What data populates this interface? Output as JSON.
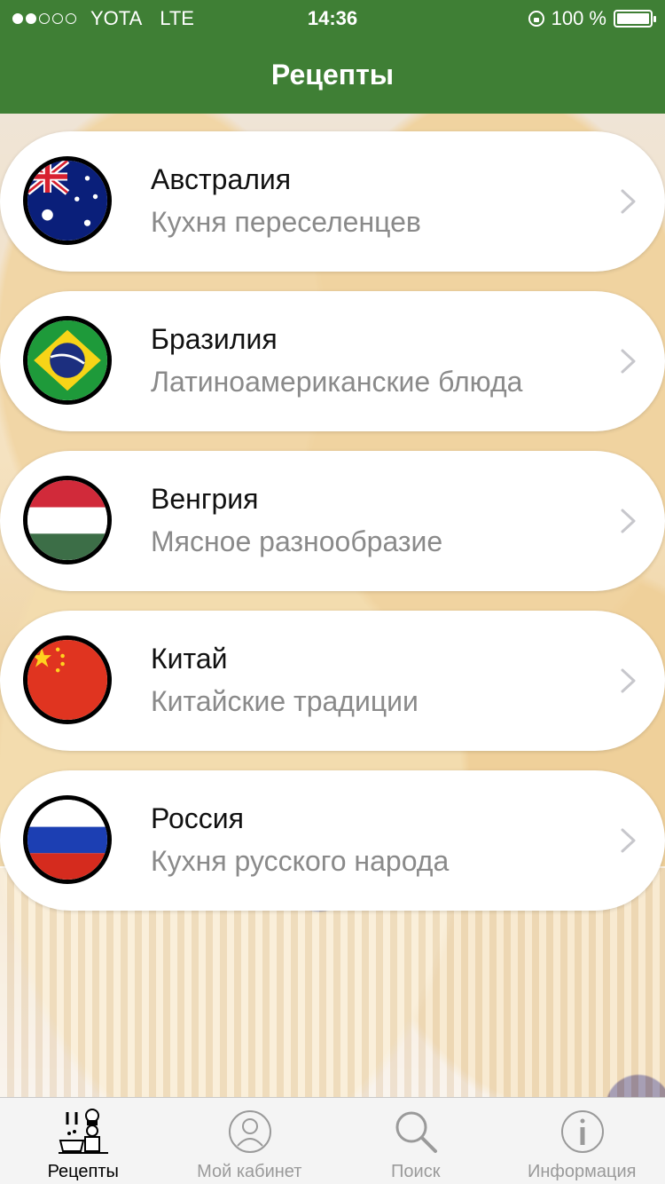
{
  "status_bar": {
    "carrier": "YOTA",
    "network": "LTE",
    "time": "14:36",
    "battery": "100 %"
  },
  "nav": {
    "title": "Рецепты"
  },
  "colors": {
    "header_green": "#3f7f35"
  },
  "list": [
    {
      "title": "Австралия",
      "subtitle": "Кухня переселенцев",
      "icon": "australia-flag-icon"
    },
    {
      "title": "Бразилия",
      "subtitle": "Латиноамериканские блюда",
      "icon": "brazil-flag-icon"
    },
    {
      "title": "Венгрия",
      "subtitle": "Мясное разнообразие",
      "icon": "hungary-flag-icon"
    },
    {
      "title": "Китай",
      "subtitle": "Китайские традиции",
      "icon": "china-flag-icon"
    },
    {
      "title": "Россия",
      "subtitle": "Кухня русского народа",
      "icon": "russia-flag-icon"
    }
  ],
  "tabs": [
    {
      "label": "Рецепты",
      "icon": "chef-icon",
      "active": true
    },
    {
      "label": "Мой кабинет",
      "icon": "user-icon",
      "active": false
    },
    {
      "label": "Поиск",
      "icon": "search-icon",
      "active": false
    },
    {
      "label": "Информация",
      "icon": "info-icon",
      "active": false
    }
  ]
}
